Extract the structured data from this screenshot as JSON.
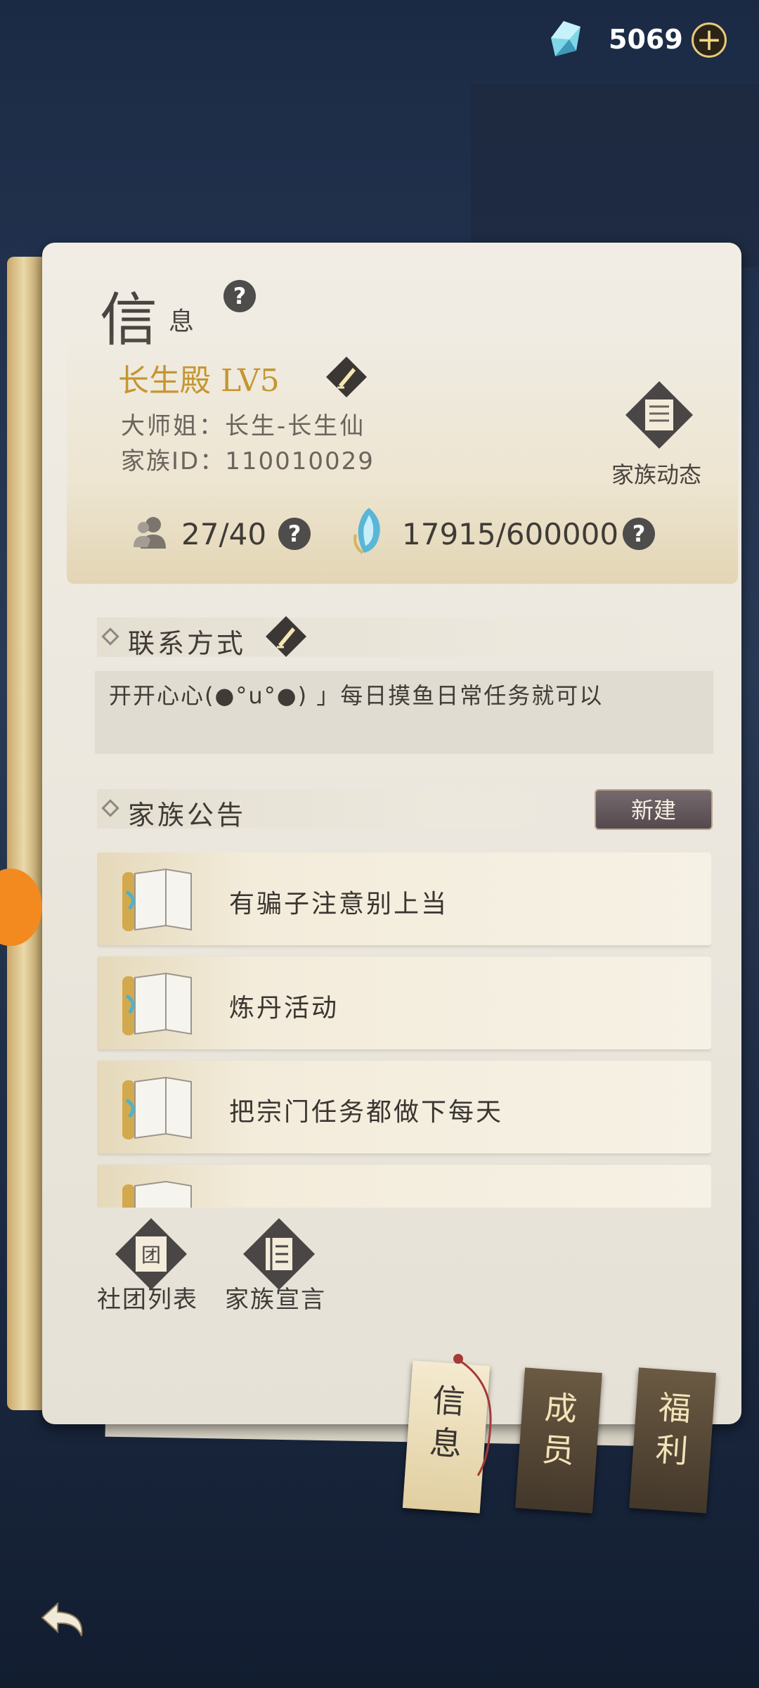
{
  "currency": {
    "value": "5069",
    "icon": "spirit-crystal-icon",
    "add_icon": "plus-icon"
  },
  "page": {
    "title_big": "信",
    "title_small": "息",
    "help_icon": "question-icon"
  },
  "family": {
    "name": "长生殿 LV5",
    "leader": "大师姐：长生-长生仙",
    "id": "家族ID：110010029",
    "news_label": "家族动态",
    "members": "27/40",
    "exp": "17915/600000"
  },
  "contact": {
    "label": "联系方式",
    "text": "开开心心(●°u°●) 」每日摸鱼日常任务就可以"
  },
  "notices": {
    "label": "家族公告",
    "new_label": "新建",
    "items": [
      {
        "text": "有骗子注意别上当"
      },
      {
        "text": "炼丹活动"
      },
      {
        "text": "把宗门任务都做下每天"
      },
      {
        "text": ""
      }
    ]
  },
  "shortcuts": [
    {
      "label": "社团列表",
      "icon": "club-list-icon"
    },
    {
      "label": "家族宣言",
      "icon": "manifesto-icon"
    }
  ],
  "tabs": [
    {
      "label": "信\n息",
      "active": true
    },
    {
      "label": "成\n员",
      "active": false
    },
    {
      "label": "福\n利",
      "active": false
    }
  ],
  "colors": {
    "gold": "#c59631",
    "paper": "#ece8df",
    "ink": "#3f3b36"
  }
}
